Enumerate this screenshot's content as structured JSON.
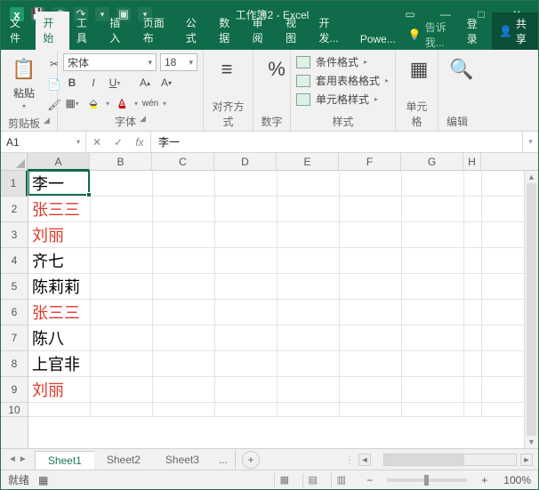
{
  "titlebar": {
    "title": "工作簿2 - Excel"
  },
  "tabs": {
    "file": "文件",
    "home": "开始",
    "tools": "工具",
    "insert": "插入",
    "layout": "页面布",
    "formulas": "公式",
    "data": "数据",
    "review": "审阅",
    "view": "视图",
    "dev": "开发...",
    "power": "Powe...",
    "tell": "告诉我...",
    "login": "登录",
    "share": "共享"
  },
  "ribbon": {
    "clipboard": {
      "label": "剪贴板",
      "paste": "粘贴"
    },
    "font": {
      "label": "字体",
      "name": "宋体",
      "size": "18",
      "wen": "wén"
    },
    "align": {
      "label": "对齐方式"
    },
    "number": {
      "label": "数字"
    },
    "styles": {
      "label": "样式",
      "cond": "条件格式",
      "table": "套用表格格式",
      "cell": "单元格样式"
    },
    "cells": {
      "label": "单元格"
    },
    "editing": {
      "label": "编辑"
    }
  },
  "namebox": "A1",
  "formula_fx": "fx",
  "formula_value": "李一",
  "columns": [
    "A",
    "B",
    "C",
    "D",
    "E",
    "F",
    "G",
    "H"
  ],
  "rows": [
    {
      "n": "1",
      "a": "李一",
      "red": false
    },
    {
      "n": "2",
      "a": "张三三",
      "red": true
    },
    {
      "n": "3",
      "a": "刘丽",
      "red": true
    },
    {
      "n": "4",
      "a": "齐七",
      "red": false
    },
    {
      "n": "5",
      "a": "陈莉莉",
      "red": false
    },
    {
      "n": "6",
      "a": "张三三",
      "red": true
    },
    {
      "n": "7",
      "a": "陈八",
      "red": false
    },
    {
      "n": "8",
      "a": "上官非",
      "red": false
    },
    {
      "n": "9",
      "a": "刘丽",
      "red": true
    },
    {
      "n": "10",
      "a": "",
      "red": false
    }
  ],
  "sheets": {
    "s1": "Sheet1",
    "s2": "Sheet2",
    "s3": "Sheet3",
    "dots": "..."
  },
  "status": {
    "ready": "就绪",
    "zoom": "100%"
  }
}
